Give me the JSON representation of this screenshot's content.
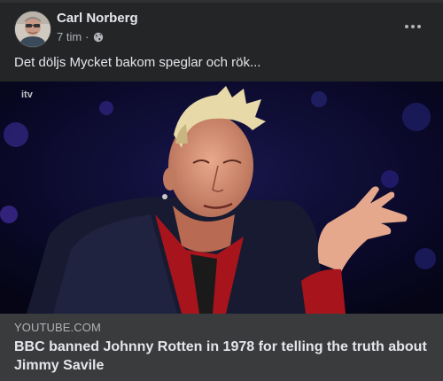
{
  "post": {
    "author": "Carl Norberg",
    "time": "7 tim",
    "separator": "·",
    "privacy_icon": "globe-icon",
    "more_icon": "more-horizontal-icon",
    "text": "Det döljs Mycket bakom speglar och rök..."
  },
  "media": {
    "watermark": "itv",
    "description_icon": "video-thumbnail"
  },
  "link_preview": {
    "domain": "YOUTUBE.COM",
    "title": "BBC banned Johnny Rotten in 1978 for telling the truth about Jimmy Savile"
  },
  "colors": {
    "background": "#242526",
    "link_box": "#3a3b3c",
    "primary_text": "#e4e6eb",
    "secondary_text": "#b0b3b8"
  }
}
